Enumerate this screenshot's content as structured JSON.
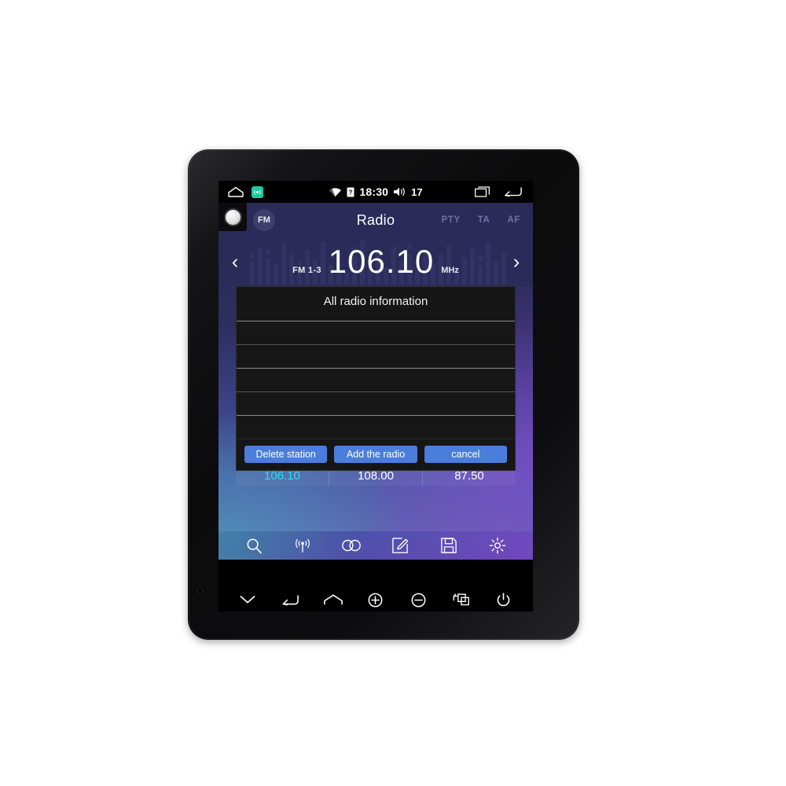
{
  "statusbar": {
    "home_icon": "home-outline-icon",
    "gps_icon": "gps-location-icon",
    "wifi_icon": "wifi-icon",
    "sim_icon": "sim-card-unknown-icon",
    "time": "18:30",
    "volume_icon": "volume-up-icon",
    "volume_level": "17",
    "recents_icon": "recent-apps-icon",
    "back_icon": "back-arrow-icon"
  },
  "app": {
    "knob": "rotary-volume-knob",
    "band_badge": "FM",
    "title": "Radio",
    "rds": [
      {
        "label": "PTY"
      },
      {
        "label": "TA"
      },
      {
        "label": "AF"
      }
    ],
    "tuner": {
      "prev_icon": "chevron-left-icon",
      "next_icon": "chevron-right-icon",
      "band_label": "FM 1-3",
      "frequency": "106.10",
      "unit": "MHz"
    },
    "presets": [
      {
        "value": "106.10",
        "active": true
      },
      {
        "value": "108.00",
        "active": false
      },
      {
        "value": "87.50",
        "active": false
      }
    ],
    "dialog": {
      "title": "All radio information",
      "rows": [
        "",
        "",
        "",
        "",
        ""
      ],
      "buttons": [
        {
          "label": "Delete station"
        },
        {
          "label": "Add the radio"
        },
        {
          "label": "cancel"
        }
      ]
    },
    "toolbar": [
      {
        "icon": "search-icon"
      },
      {
        "icon": "radio-tower-icon"
      },
      {
        "icon": "stereo-icon"
      },
      {
        "icon": "edit-icon"
      },
      {
        "icon": "save-icon"
      },
      {
        "icon": "settings-gear-icon"
      }
    ]
  },
  "navbar": [
    {
      "icon": "chevron-down-icon"
    },
    {
      "icon": "back-arrow-icon"
    },
    {
      "icon": "home-icon"
    },
    {
      "icon": "volume-plus-icon"
    },
    {
      "icon": "volume-minus-icon"
    },
    {
      "icon": "switch-app-icon"
    },
    {
      "icon": "power-icon"
    }
  ],
  "colors": {
    "accent_blue": "#4a7ddc",
    "active_preset": "#2fe0e8",
    "header_navy": "#2a2b58",
    "dialog_bg": "#161616",
    "gps_badge": "#22c7a0"
  }
}
